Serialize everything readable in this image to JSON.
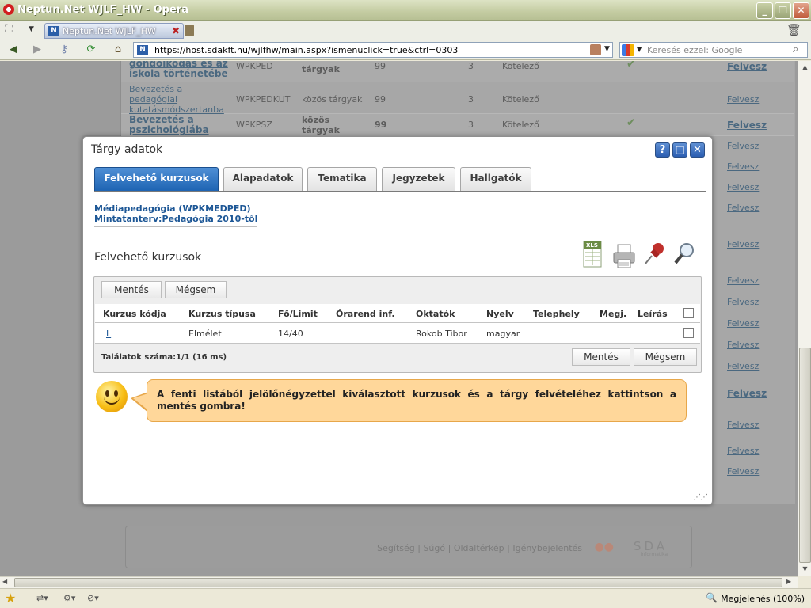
{
  "window": {
    "title": "Neptun.Net WJLF_HW - Opera"
  },
  "tabbar": {
    "tab_label": "Neptun.Net WJLF_HW"
  },
  "address": {
    "url": "https://host.sdakft.hu/wjlfhw/main.aspx?ismenuclick=true&ctrl=0303",
    "search_placeholder": "Keresés ezzel: Google"
  },
  "background_rows": [
    {
      "name": "gondolkodás és az iskola történetébe",
      "prefix": "",
      "code": "WPKPED",
      "type": "tárgyak",
      "num": "99",
      "kr": "3",
      "req": "Kötelező",
      "action": "Felvesz",
      "bold": true,
      "check": true
    },
    {
      "name": "Bevezetés a pedagógiai kutatásmódszertanba",
      "code": "WPKPEDKUT",
      "type": "közös tárgyak",
      "num": "99",
      "kr": "3",
      "req": "Kötelező",
      "action": "Felvesz",
      "bold": false,
      "check": false
    },
    {
      "name": "Bevezetés a pszichológiába",
      "code": "WPKPSZ",
      "type": "közös tárgyak",
      "num": "99",
      "kr": "3",
      "req": "Kötelező",
      "action": "Felvesz",
      "bold": true,
      "check": true
    }
  ],
  "background_actions": [
    "Felvesz",
    "Felvesz",
    "Felvesz",
    "Felvesz",
    "Felvesz",
    "Felvesz",
    "Felvesz",
    "Felvesz",
    "Felvesz",
    "Felvesz",
    "Felvesz",
    "Felvesz",
    "Felvesz",
    "Felvesz"
  ],
  "footer": {
    "links": "Segítség | Súgó | Oldaltérkép | Igénybejelentés",
    "logo": "SDA",
    "logo_sub": "informatika"
  },
  "modal": {
    "title": "Tárgy adatok",
    "tabs": [
      "Felvehető kurzusok",
      "Alapadatok",
      "Tematika",
      "Jegyzetek",
      "Hallgatók"
    ],
    "active_tab": 0,
    "subject_line1": "Médiapedagógia (WPKMEDPED)",
    "subject_line2": "Mintatanterv:Pedagógia 2010-től",
    "section_title": "Felvehető kurzusok",
    "icons": [
      "xls-export-icon",
      "print-icon",
      "pin-icon",
      "search-icon"
    ],
    "grid": {
      "save_label": "Mentés",
      "cancel_label": "Mégsem",
      "columns": [
        "Kurzus kódja",
        "Kurzus típusa",
        "Fő/Limit",
        "Órarend inf.",
        "Oktatók",
        "Nyelv",
        "Telephely",
        "Megj.",
        "Leírás"
      ],
      "rows": [
        {
          "code": "L",
          "type": "Elmélet",
          "limit": "14/40",
          "schedule": "",
          "teacher": "Rokob Tibor",
          "lang": "magyar",
          "site": "",
          "note": "",
          "desc": ""
        }
      ],
      "results": "Találatok száma:1/1 (16 ms)"
    },
    "hint": "A fenti listából jelölőnégyzettel kiválasztott kurzusok és a tárgy felvételéhez kattintson a mentés gombra!"
  },
  "status": {
    "zoom": "Megjelenés (100%)"
  },
  "colors": {
    "accent": "#1E64B3",
    "hint_bg": "#FFD79A",
    "overlay": "#9B9B9B"
  }
}
